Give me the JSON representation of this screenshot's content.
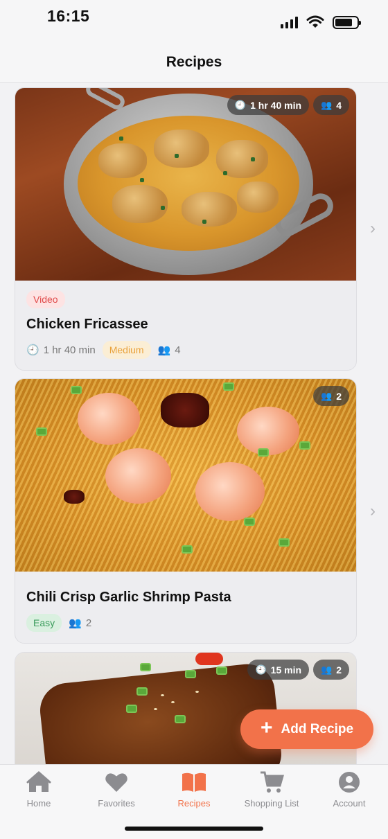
{
  "status_bar": {
    "time": "16:15"
  },
  "header": {
    "title": "Recipes"
  },
  "recipes": [
    {
      "title": "Chicken Fricassee",
      "tag": "Video",
      "overlay_time": "1 hr 40 min",
      "overlay_servings": "4",
      "meta_time": "1 hr 40 min",
      "difficulty": "Medium",
      "servings": "4"
    },
    {
      "title": "Chili Crisp Garlic Shrimp Pasta",
      "overlay_servings": "2",
      "difficulty": "Easy",
      "servings": "2"
    },
    {
      "overlay_time": "15 min",
      "overlay_servings": "2"
    }
  ],
  "fab": {
    "label": "Add Recipe"
  },
  "tabs": [
    {
      "label": "Home",
      "icon": "home-icon"
    },
    {
      "label": "Favorites",
      "icon": "heart-icon"
    },
    {
      "label": "Recipes",
      "icon": "book-icon",
      "active": true
    },
    {
      "label": "Shopping List",
      "icon": "cart-icon"
    },
    {
      "label": "Account",
      "icon": "person-icon"
    }
  ],
  "colors": {
    "accent": "#f2724a",
    "video": "#e04a4a",
    "medium": "#e9a23b",
    "easy": "#3a9b5b"
  }
}
